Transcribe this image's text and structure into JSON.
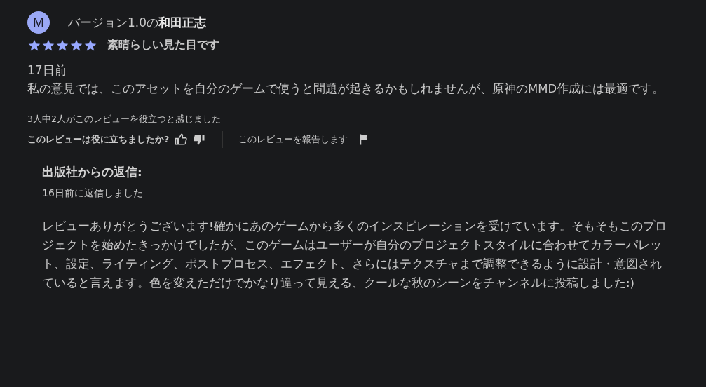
{
  "review": {
    "avatar": "M",
    "author": "バージョン1.0の**和田正志**",
    "stars": 5,
    "title": "素晴らしい見た目です",
    "date": "17日前",
    "body": "私の意見では、このアセットを自分のゲームで使うと問題が起きるかもしれませんが、原神のMMD作成には最適です。",
    "helpful_count": "3人中2人がこのレビューを役立つと感じました",
    "helpful_question": "このレビューは役に立ちましたか?",
    "report": "このレビューを報告します"
  },
  "reply": {
    "heading": "出版社からの返信:",
    "date": "16日前に返信しました",
    "body": "レビューありがとうございます!確かにあのゲームから多くのインスピレーションを受けています。そもそもこのプロジェクトを始めたきっかけでしたが、このゲームはユーザーが自分のプロジェクトスタイルに合わせてカラーパレット、設定、ライティング、ポストプロセス、エフェクト、さらにはテクスチャまで調整できるように設計・意図されていると言えます。色を変えただけでかなり違って見える、クールな秋のシーンをチャンネルに投稿しました:)"
  }
}
